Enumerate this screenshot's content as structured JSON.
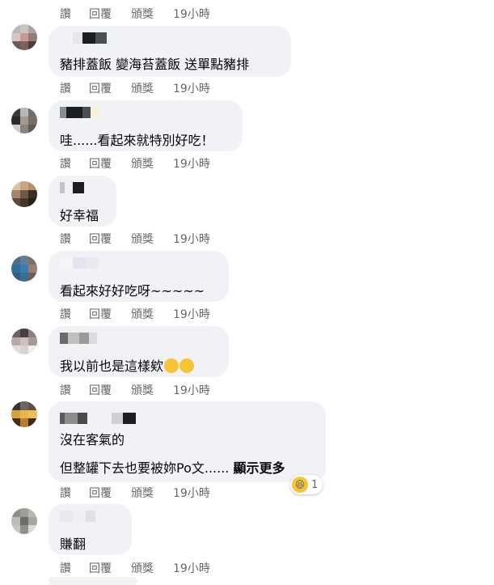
{
  "action_labels": {
    "like": "讚",
    "reply": "回覆",
    "award": "頒獎",
    "time": "19小時"
  },
  "comments": [
    {
      "text": "豬排蓋飯 變海苔蓋飯 送單點豬排"
    },
    {
      "text": "哇......看起來就特別好吃！"
    },
    {
      "text": "好幸福"
    },
    {
      "text": "看起來好好吃呀~~~~~"
    },
    {
      "text": "我以前也是這樣欸"
    },
    {
      "text_line1": "沒在客氣的",
      "text_line2": "但整罐下去也要被妳Po文......",
      "more": "顯示更多",
      "reaction_count": "1"
    },
    {
      "text": "賺翻"
    }
  ],
  "colors": {
    "bubble": "#f0f2f5",
    "meta": "#65676b",
    "text": "#050505"
  }
}
